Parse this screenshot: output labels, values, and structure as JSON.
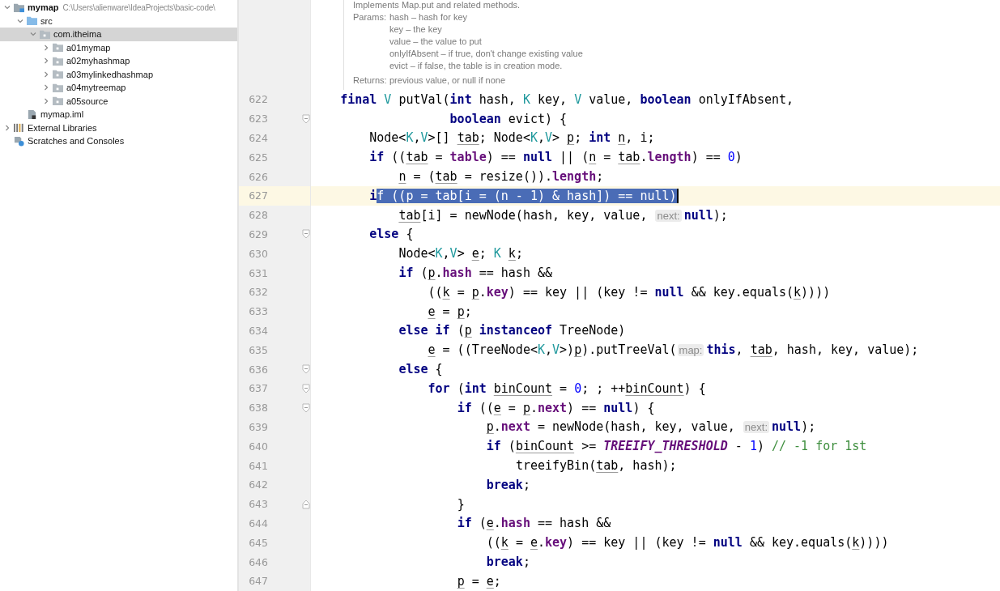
{
  "project_tree": [
    {
      "label": "mymap",
      "path": "C:\\Users\\alienware\\IdeaProjects\\basic-code\\",
      "kind": "module",
      "expanded": true,
      "selected": false,
      "children": [
        {
          "label": "src",
          "kind": "source",
          "expanded": true,
          "selected": false,
          "children": [
            {
              "label": "com.itheima",
              "kind": "package",
              "expanded": true,
              "selected": true,
              "children": [
                {
                  "label": "a01mymap",
                  "kind": "package",
                  "expanded": false,
                  "selected": false
                },
                {
                  "label": "a02myhashmap",
                  "kind": "package",
                  "expanded": false,
                  "selected": false
                },
                {
                  "label": "a03mylinkedhashmap",
                  "kind": "package",
                  "expanded": false,
                  "selected": false
                },
                {
                  "label": "a04mytreemap",
                  "kind": "package",
                  "expanded": false,
                  "selected": false
                },
                {
                  "label": "a05source",
                  "kind": "package",
                  "expanded": false,
                  "selected": false
                }
              ]
            }
          ]
        },
        {
          "label": "mymap.iml",
          "kind": "file",
          "selected": false
        }
      ]
    },
    {
      "label": "External Libraries",
      "kind": "library",
      "expanded": false,
      "selected": false
    },
    {
      "label": "Scratches and Consoles",
      "kind": "scratches",
      "selected": false
    }
  ],
  "doc": {
    "summary": "Implements Map.put and related methods.",
    "params_label": "Params:",
    "params": [
      "hash – hash for key",
      "key – the key",
      "value – the value to put",
      "onlyIfAbsent – if true, don't change existing value",
      "evict – if false, the table is in creation mode."
    ],
    "returns_label": "Returns:",
    "returns": "previous value, or null if none"
  },
  "lines": [
    {
      "number": "622",
      "current": false,
      "kind": "plain",
      "tokens": [
        {
          "kind": "kw",
          "text": "    final"
        },
        {
          "kind": "type",
          "text": " V"
        },
        {
          "kind": "plain",
          "text": " putVal("
        },
        {
          "kind": "kw",
          "text": "int"
        },
        {
          "kind": "plain",
          "text": " hash, "
        },
        {
          "kind": "type",
          "text": "K"
        },
        {
          "kind": "plain",
          "text": " key, "
        },
        {
          "kind": "type",
          "text": "V"
        },
        {
          "kind": "plain",
          "text": " value, "
        },
        {
          "kind": "kw",
          "text": "boolean"
        },
        {
          "kind": "plain",
          "text": " onlyIfAbsent,"
        }
      ]
    },
    {
      "number": "623",
      "current": false,
      "kind": "fold-start",
      "tokens": [
        {
          "kind": "kw",
          "text": "                   boolean"
        },
        {
          "kind": "plain",
          "text": " evict) {"
        }
      ]
    },
    {
      "number": "624",
      "current": false,
      "kind": "plain",
      "tokens": [
        {
          "kind": "plain",
          "text": "        Node<"
        },
        {
          "kind": "type",
          "text": "K"
        },
        {
          "kind": "plain",
          "text": ","
        },
        {
          "kind": "type",
          "text": "V"
        },
        {
          "kind": "plain",
          "text": ">[] "
        },
        {
          "kind": "var",
          "text": "tab"
        },
        {
          "kind": "plain",
          "text": "; Node<"
        },
        {
          "kind": "type",
          "text": "K"
        },
        {
          "kind": "plain",
          "text": ","
        },
        {
          "kind": "type",
          "text": "V"
        },
        {
          "kind": "plain",
          "text": "> "
        },
        {
          "kind": "var",
          "text": "p"
        },
        {
          "kind": "plain",
          "text": "; "
        },
        {
          "kind": "kw",
          "text": "int"
        },
        {
          "kind": "var",
          "text": " n"
        },
        {
          "kind": "plain",
          "text": ", i;"
        }
      ]
    },
    {
      "number": "625",
      "current": false,
      "kind": "plain",
      "tokens": [
        {
          "kind": "kw",
          "text": "        if"
        },
        {
          "kind": "plain",
          "text": " (("
        },
        {
          "kind": "var",
          "text": "tab"
        },
        {
          "kind": "plain",
          "text": " = "
        },
        {
          "kind": "field",
          "text": "table"
        },
        {
          "kind": "plain",
          "text": ") == "
        },
        {
          "kind": "kw",
          "text": "null"
        },
        {
          "kind": "plain",
          "text": " || ("
        },
        {
          "kind": "var",
          "text": "n"
        },
        {
          "kind": "plain",
          "text": " = "
        },
        {
          "kind": "var",
          "text": "tab"
        },
        {
          "kind": "plain",
          "text": "."
        },
        {
          "kind": "field",
          "text": "length"
        },
        {
          "kind": "plain",
          "text": ") == "
        },
        {
          "kind": "num",
          "text": "0"
        },
        {
          "kind": "plain",
          "text": ")"
        }
      ]
    },
    {
      "number": "626",
      "current": false,
      "kind": "plain",
      "tokens": [
        {
          "kind": "var",
          "text": "            n"
        },
        {
          "kind": "plain",
          "text": " = ("
        },
        {
          "kind": "var",
          "text": "tab"
        },
        {
          "kind": "plain",
          "text": " = resize())."
        },
        {
          "kind": "field",
          "text": "length"
        },
        {
          "kind": "plain",
          "text": ";"
        }
      ]
    },
    {
      "number": "627",
      "current": true,
      "kind": "plain",
      "tokens": [
        {
          "kind": "kw",
          "text": "        i"
        },
        {
          "kind": "selection",
          "text": "f ((p = tab[i = (n - 1) & hash]) == null)"
        }
      ]
    },
    {
      "number": "628",
      "current": false,
      "kind": "plain",
      "tokens": [
        {
          "kind": "var",
          "text": "            tab"
        },
        {
          "kind": "plain",
          "text": "[i] = newNode(hash, key, value, "
        },
        {
          "kind": "hint",
          "text": "next:"
        },
        {
          "kind": "kw",
          "text": "null"
        },
        {
          "kind": "plain",
          "text": ");"
        }
      ]
    },
    {
      "number": "629",
      "current": false,
      "kind": "fold-start",
      "tokens": [
        {
          "kind": "kw",
          "text": "        else"
        },
        {
          "kind": "plain",
          "text": " {"
        }
      ]
    },
    {
      "number": "630",
      "current": false,
      "kind": "plain",
      "tokens": [
        {
          "kind": "plain",
          "text": "            Node<"
        },
        {
          "kind": "type",
          "text": "K"
        },
        {
          "kind": "plain",
          "text": ","
        },
        {
          "kind": "type",
          "text": "V"
        },
        {
          "kind": "plain",
          "text": "> "
        },
        {
          "kind": "var",
          "text": "e"
        },
        {
          "kind": "plain",
          "text": "; "
        },
        {
          "kind": "type",
          "text": "K"
        },
        {
          "kind": "var",
          "text": " k"
        },
        {
          "kind": "plain",
          "text": ";"
        }
      ]
    },
    {
      "number": "631",
      "current": false,
      "kind": "plain",
      "tokens": [
        {
          "kind": "kw",
          "text": "            if"
        },
        {
          "kind": "plain",
          "text": " ("
        },
        {
          "kind": "var",
          "text": "p"
        },
        {
          "kind": "plain",
          "text": "."
        },
        {
          "kind": "field",
          "text": "hash"
        },
        {
          "kind": "plain",
          "text": " == hash &&"
        }
      ]
    },
    {
      "number": "632",
      "current": false,
      "kind": "plain",
      "tokens": [
        {
          "kind": "plain",
          "text": "                (("
        },
        {
          "kind": "var",
          "text": "k"
        },
        {
          "kind": "plain",
          "text": " = "
        },
        {
          "kind": "var",
          "text": "p"
        },
        {
          "kind": "plain",
          "text": "."
        },
        {
          "kind": "field",
          "text": "key"
        },
        {
          "kind": "plain",
          "text": ") == key || (key != "
        },
        {
          "kind": "kw",
          "text": "null"
        },
        {
          "kind": "plain",
          "text": " && key.equals("
        },
        {
          "kind": "var",
          "text": "k"
        },
        {
          "kind": "plain",
          "text": "))))"
        }
      ]
    },
    {
      "number": "633",
      "current": false,
      "kind": "plain",
      "tokens": [
        {
          "kind": "var",
          "text": "                e"
        },
        {
          "kind": "plain",
          "text": " = "
        },
        {
          "kind": "var",
          "text": "p"
        },
        {
          "kind": "plain",
          "text": ";"
        }
      ]
    },
    {
      "number": "634",
      "current": false,
      "kind": "plain",
      "tokens": [
        {
          "kind": "kw",
          "text": "            else if"
        },
        {
          "kind": "plain",
          "text": " ("
        },
        {
          "kind": "var",
          "text": "p"
        },
        {
          "kind": "kw",
          "text": " instanceof"
        },
        {
          "kind": "plain",
          "text": " TreeNode)"
        }
      ]
    },
    {
      "number": "635",
      "current": false,
      "kind": "plain",
      "tokens": [
        {
          "kind": "var",
          "text": "                e"
        },
        {
          "kind": "plain",
          "text": " = ((TreeNode<"
        },
        {
          "kind": "type",
          "text": "K"
        },
        {
          "kind": "plain",
          "text": ","
        },
        {
          "kind": "type",
          "text": "V"
        },
        {
          "kind": "plain",
          "text": ">)"
        },
        {
          "kind": "var",
          "text": "p"
        },
        {
          "kind": "plain",
          "text": ").putTreeVal("
        },
        {
          "kind": "hint",
          "text": "map:"
        },
        {
          "kind": "kw",
          "text": "this"
        },
        {
          "kind": "plain",
          "text": ", "
        },
        {
          "kind": "var",
          "text": "tab"
        },
        {
          "kind": "plain",
          "text": ", hash, key, value);"
        }
      ]
    },
    {
      "number": "636",
      "current": false,
      "kind": "fold-start",
      "tokens": [
        {
          "kind": "kw",
          "text": "            else"
        },
        {
          "kind": "plain",
          "text": " {"
        }
      ]
    },
    {
      "number": "637",
      "current": false,
      "kind": "fold-start",
      "tokens": [
        {
          "kind": "kw",
          "text": "                for"
        },
        {
          "kind": "plain",
          "text": " ("
        },
        {
          "kind": "kw",
          "text": "int"
        },
        {
          "kind": "var",
          "text": " binCount"
        },
        {
          "kind": "plain",
          "text": " = "
        },
        {
          "kind": "num",
          "text": "0"
        },
        {
          "kind": "plain",
          "text": "; ; ++"
        },
        {
          "kind": "var",
          "text": "binCount"
        },
        {
          "kind": "plain",
          "text": ") {"
        }
      ]
    },
    {
      "number": "638",
      "current": false,
      "kind": "fold-start",
      "tokens": [
        {
          "kind": "kw",
          "text": "                    if"
        },
        {
          "kind": "plain",
          "text": " (("
        },
        {
          "kind": "var",
          "text": "e"
        },
        {
          "kind": "plain",
          "text": " = "
        },
        {
          "kind": "var",
          "text": "p"
        },
        {
          "kind": "plain",
          "text": "."
        },
        {
          "kind": "field",
          "text": "next"
        },
        {
          "kind": "plain",
          "text": ") == "
        },
        {
          "kind": "kw",
          "text": "null"
        },
        {
          "kind": "plain",
          "text": ") {"
        }
      ]
    },
    {
      "number": "639",
      "current": false,
      "kind": "plain",
      "tokens": [
        {
          "kind": "var",
          "text": "                        p"
        },
        {
          "kind": "plain",
          "text": "."
        },
        {
          "kind": "field",
          "text": "next"
        },
        {
          "kind": "plain",
          "text": " = newNode(hash, key, value, "
        },
        {
          "kind": "hint",
          "text": "next:"
        },
        {
          "kind": "kw",
          "text": "null"
        },
        {
          "kind": "plain",
          "text": ");"
        }
      ]
    },
    {
      "number": "640",
      "current": false,
      "kind": "plain",
      "tokens": [
        {
          "kind": "kw",
          "text": "                        if"
        },
        {
          "kind": "plain",
          "text": " ("
        },
        {
          "kind": "var",
          "text": "binCount"
        },
        {
          "kind": "plain",
          "text": " >= "
        },
        {
          "kind": "const",
          "text": "TREEIFY_THRESHOLD"
        },
        {
          "kind": "plain",
          "text": " - "
        },
        {
          "kind": "num",
          "text": "1"
        },
        {
          "kind": "plain",
          "text": ") "
        },
        {
          "kind": "comment",
          "text": "// -1 for 1st"
        }
      ]
    },
    {
      "number": "641",
      "current": false,
      "kind": "plain",
      "tokens": [
        {
          "kind": "plain",
          "text": "                            treeifyBin("
        },
        {
          "kind": "var",
          "text": "tab"
        },
        {
          "kind": "plain",
          "text": ", hash);"
        }
      ]
    },
    {
      "number": "642",
      "current": false,
      "kind": "plain",
      "tokens": [
        {
          "kind": "kw",
          "text": "                        break"
        },
        {
          "kind": "plain",
          "text": ";"
        }
      ]
    },
    {
      "number": "643",
      "current": false,
      "kind": "fold-end",
      "tokens": [
        {
          "kind": "plain",
          "text": "                    }"
        }
      ]
    },
    {
      "number": "644",
      "current": false,
      "kind": "plain",
      "tokens": [
        {
          "kind": "kw",
          "text": "                    if"
        },
        {
          "kind": "plain",
          "text": " ("
        },
        {
          "kind": "var",
          "text": "e"
        },
        {
          "kind": "plain",
          "text": "."
        },
        {
          "kind": "field",
          "text": "hash"
        },
        {
          "kind": "plain",
          "text": " == hash &&"
        }
      ]
    },
    {
      "number": "645",
      "current": false,
      "kind": "plain",
      "tokens": [
        {
          "kind": "plain",
          "text": "                        (("
        },
        {
          "kind": "var",
          "text": "k"
        },
        {
          "kind": "plain",
          "text": " = "
        },
        {
          "kind": "var",
          "text": "e"
        },
        {
          "kind": "plain",
          "text": "."
        },
        {
          "kind": "field",
          "text": "key"
        },
        {
          "kind": "plain",
          "text": ") == key || (key != "
        },
        {
          "kind": "kw",
          "text": "null"
        },
        {
          "kind": "plain",
          "text": " && key.equals("
        },
        {
          "kind": "var",
          "text": "k"
        },
        {
          "kind": "plain",
          "text": "))))"
        }
      ]
    },
    {
      "number": "646",
      "current": false,
      "kind": "plain",
      "tokens": [
        {
          "kind": "kw",
          "text": "                        break"
        },
        {
          "kind": "plain",
          "text": ";"
        }
      ]
    },
    {
      "number": "647",
      "current": false,
      "kind": "plain",
      "tokens": [
        {
          "kind": "var",
          "text": "                    p"
        },
        {
          "kind": "plain",
          "text": " = "
        },
        {
          "kind": "var",
          "text": "e"
        },
        {
          "kind": "plain",
          "text": ";"
        }
      ]
    }
  ]
}
